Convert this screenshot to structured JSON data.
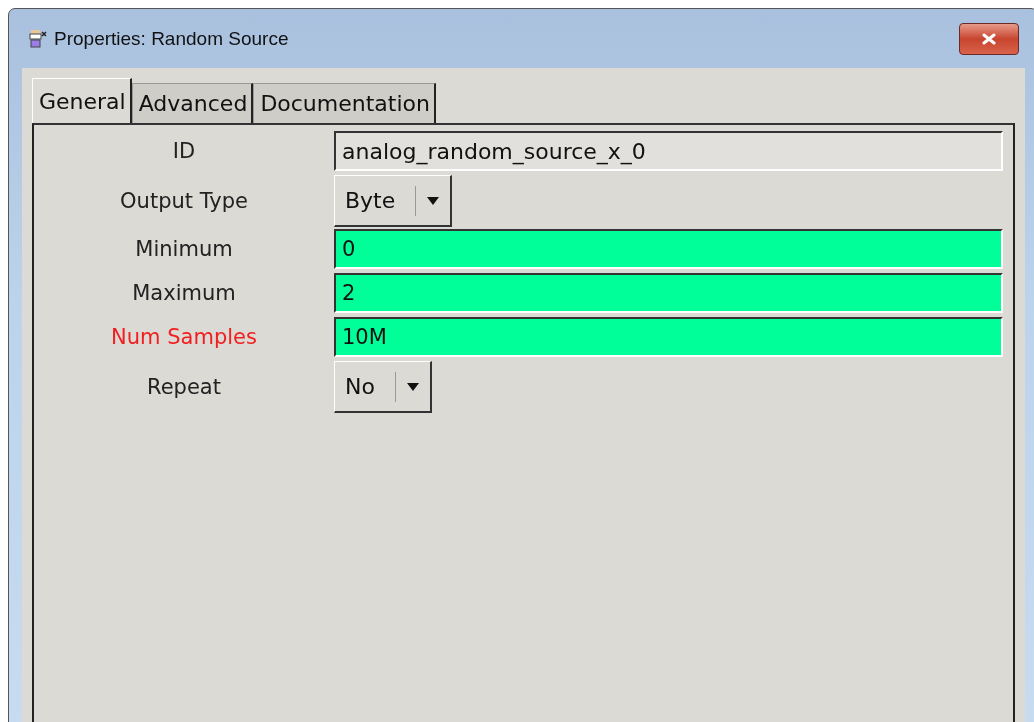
{
  "window": {
    "title": "Properties: Random Source"
  },
  "tabs": [
    {
      "label": "General",
      "selected": true
    },
    {
      "label": "Advanced",
      "selected": false
    },
    {
      "label": "Documentation",
      "selected": false
    }
  ],
  "params": [
    {
      "label": "ID",
      "error": false,
      "kind": "readonly",
      "value": "analog_random_source_x_0"
    },
    {
      "label": "Output Type",
      "error": false,
      "kind": "enum",
      "value": "Byte"
    },
    {
      "label": "Minimum",
      "error": false,
      "kind": "entry",
      "value": "0"
    },
    {
      "label": "Maximum",
      "error": false,
      "kind": "entry",
      "value": "2"
    },
    {
      "label": "Num Samples",
      "error": true,
      "kind": "entry",
      "value": "10M"
    },
    {
      "label": "Repeat",
      "error": false,
      "kind": "enum",
      "value": "No"
    }
  ]
}
